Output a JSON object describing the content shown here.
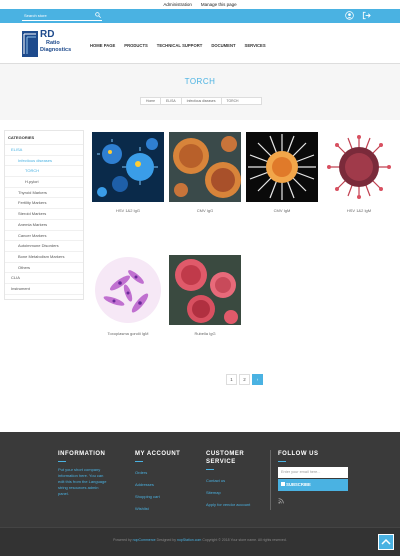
{
  "adminbar": {
    "admin": "Administration",
    "manage": "Manage this page"
  },
  "search": {
    "placeholder": "Search store"
  },
  "logo": {
    "rd": "RD",
    "ratio": "Ratio",
    "diag": "Diagnostics"
  },
  "nav": [
    "HOME PAGE",
    "PRODUCTS",
    "TECHNICAL SUPPORT",
    "DOCUMENT",
    "SERVICES"
  ],
  "page_title": "TORCH",
  "breadcrumb": [
    "Home",
    "ELISA",
    "Infectious diseases",
    "TORCH"
  ],
  "sidebar": {
    "heading": "CATEGORIES",
    "items": [
      {
        "label": "ELISA",
        "level": 0,
        "active": true
      },
      {
        "label": "Infectious diseases",
        "level": 1,
        "active": true
      },
      {
        "label": "TORCH",
        "level": 2,
        "active": true
      },
      {
        "label": "H.pylori",
        "level": 2,
        "active": false
      },
      {
        "label": "Thyroid Markers",
        "level": 1,
        "active": false
      },
      {
        "label": "Fertility Markers",
        "level": 1,
        "active": false
      },
      {
        "label": "Steroid Markers",
        "level": 1,
        "active": false
      },
      {
        "label": "Anemia Markers",
        "level": 1,
        "active": false
      },
      {
        "label": "Cancer Markers",
        "level": 1,
        "active": false
      },
      {
        "label": "Autoimmune Disorders",
        "level": 1,
        "active": false
      },
      {
        "label": "Bone Metabolism Markers",
        "level": 1,
        "active": false
      },
      {
        "label": "Others",
        "level": 1,
        "active": false
      },
      {
        "label": "CLIA",
        "level": 0,
        "active": false
      },
      {
        "label": "Instrument",
        "level": 0,
        "active": false
      }
    ]
  },
  "products": [
    {
      "name": "HSV 1&2 IgG",
      "icon": "virus-blue-image"
    },
    {
      "name": "CMV IgG",
      "icon": "virus-orange-image"
    },
    {
      "name": "CMV IgM",
      "icon": "virus-white-image"
    },
    {
      "name": "HSV 1&2 IgM",
      "icon": "virus-red-image"
    },
    {
      "name": "Toxoplasma gondii IgM",
      "icon": "toxoplasma-image"
    },
    {
      "name": "Rubella IgG",
      "icon": "rubella-image"
    }
  ],
  "pager": {
    "pages": [
      "1",
      "2"
    ],
    "current": "1",
    "next": "›"
  },
  "footer": {
    "information": {
      "heading": "INFORMATION",
      "text": "Put your short company information here. You can edit this from the Language string resources admin panel."
    },
    "my_account": {
      "heading": "MY ACCOUNT",
      "links": [
        "Orders",
        "Addresses",
        "Shopping cart",
        "Wishlist"
      ]
    },
    "customer_service": {
      "heading_line1": "CUSTOMER",
      "heading_line2": "SERVICE",
      "links": [
        "Contact us",
        "Sitemap",
        "Apply for vendor account"
      ]
    },
    "follow_us": {
      "heading": "FOLLOW US",
      "email_placeholder": "Enter your email here...",
      "subscribe": "SUBSCRIBE"
    }
  },
  "copyright": {
    "powered": "Powered by ",
    "nop": "nopCommerce",
    "designed": "  Designed by ",
    "nop2": "nopStation.com",
    "text": "  Copyright © 2018 Your store name. All rights reserved."
  },
  "colors": {
    "accent": "#4ab2e2",
    "footer_bg": "#3a3a3a",
    "brand": "#1e4a8c"
  }
}
